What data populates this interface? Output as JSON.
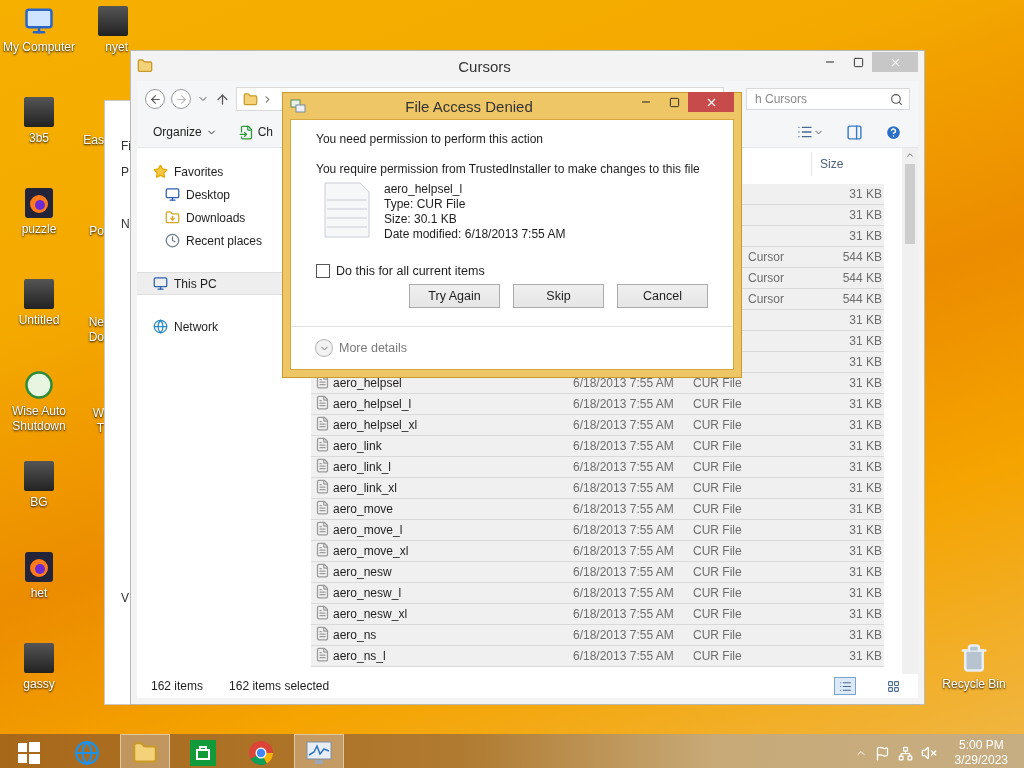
{
  "desktop_icons": [
    {
      "label": "My Computer",
      "kind": "computer"
    },
    {
      "label": "3b5",
      "kind": "photo"
    },
    {
      "label": "puzzle",
      "kind": "browser"
    },
    {
      "label": "Untitled",
      "kind": "photo"
    },
    {
      "label": "Wise Auto Shutdown",
      "kind": "clock"
    },
    {
      "label": "BG",
      "kind": "photo"
    },
    {
      "label": "het",
      "kind": "browser"
    },
    {
      "label": "gassy",
      "kind": "photo"
    }
  ],
  "desktop_icons_covered": [
    {
      "lines": [
        "nyet"
      ],
      "kind": "photo"
    },
    {
      "lines": [
        "Eas"
      ],
      "kind": "covered"
    },
    {
      "lines": [
        "Po"
      ],
      "kind": "covered"
    },
    {
      "lines": [
        "Ne",
        "Do"
      ],
      "kind": "covered"
    },
    {
      "lines": [
        "W",
        "T"
      ],
      "kind": "covered"
    }
  ],
  "recycle_bin": {
    "label": "Recycle Bin"
  },
  "background_window": {
    "fragments": [
      "Fi",
      "P",
      "N",
      "V"
    ]
  },
  "explorer": {
    "title": "Cursors",
    "search": {
      "placeholder": "h Cursors"
    },
    "toolbar": [
      "Organize",
      "Ch"
    ],
    "navigation": [
      {
        "label": "Favorites",
        "kind": "favorites",
        "selected": false,
        "children": [
          {
            "label": "Desktop",
            "kind": "desktop",
            "selected": false
          },
          {
            "label": "Downloads",
            "kind": "downloads",
            "selected": false
          },
          {
            "label": "Recent places",
            "kind": "recent",
            "selected": false
          }
        ]
      },
      {
        "label": "This PC",
        "kind": "pc",
        "selected": true
      },
      {
        "label": "Network",
        "kind": "network",
        "selected": false
      }
    ],
    "columns": [
      "Size"
    ],
    "rows": [
      {
        "kind": "covered",
        "size": "31 KB",
        "selected": true
      },
      {
        "kind": "covered",
        "size": "31 KB",
        "selected": true
      },
      {
        "kind": "covered",
        "size": "31 KB",
        "selected": true
      },
      {
        "kind": "covered",
        "type": "Cursor",
        "size": "544 KB",
        "selected": true
      },
      {
        "kind": "covered",
        "type": "Cursor",
        "size": "544 KB",
        "selected": true
      },
      {
        "kind": "covered",
        "type": "Cursor",
        "size": "544 KB",
        "selected": true
      },
      {
        "kind": "covered",
        "size": "31 KB",
        "selected": true
      },
      {
        "kind": "covered",
        "size": "31 KB",
        "selected": true
      },
      {
        "kind": "covered",
        "size": "31 KB",
        "selected": true
      },
      {
        "kind": "file",
        "name": "aero_helpsel",
        "date": "6/18/2013 7:55 AM",
        "type": "CUR File",
        "size": "31 KB",
        "selected": true
      },
      {
        "kind": "file",
        "name": "aero_helpsel_l",
        "date": "6/18/2013 7:55 AM",
        "type": "CUR File",
        "size": "31 KB",
        "selected": true
      },
      {
        "kind": "file",
        "name": "aero_helpsel_xl",
        "date": "6/18/2013 7:55 AM",
        "type": "CUR File",
        "size": "31 KB",
        "selected": true
      },
      {
        "kind": "file",
        "name": "aero_link",
        "date": "6/18/2013 7:55 AM",
        "type": "CUR File",
        "size": "31 KB",
        "selected": true
      },
      {
        "kind": "file",
        "name": "aero_link_l",
        "date": "6/18/2013 7:55 AM",
        "type": "CUR File",
        "size": "31 KB",
        "selected": true
      },
      {
        "kind": "file",
        "name": "aero_link_xl",
        "date": "6/18/2013 7:55 AM",
        "type": "CUR File",
        "size": "31 KB",
        "selected": true
      },
      {
        "kind": "file",
        "name": "aero_move",
        "date": "6/18/2013 7:55 AM",
        "type": "CUR File",
        "size": "31 KB",
        "selected": true
      },
      {
        "kind": "file",
        "name": "aero_move_l",
        "date": "6/18/2013 7:55 AM",
        "type": "CUR File",
        "size": "31 KB",
        "selected": true
      },
      {
        "kind": "file",
        "name": "aero_move_xl",
        "date": "6/18/2013 7:55 AM",
        "type": "CUR File",
        "size": "31 KB",
        "selected": true
      },
      {
        "kind": "file",
        "name": "aero_nesw",
        "date": "6/18/2013 7:55 AM",
        "type": "CUR File",
        "size": "31 KB",
        "selected": true
      },
      {
        "kind": "file",
        "name": "aero_nesw_l",
        "date": "6/18/2013 7:55 AM",
        "type": "CUR File",
        "size": "31 KB",
        "selected": true
      },
      {
        "kind": "file",
        "name": "aero_nesw_xl",
        "date": "6/18/2013 7:55 AM",
        "type": "CUR File",
        "size": "31 KB",
        "selected": true
      },
      {
        "kind": "file",
        "name": "aero_ns",
        "date": "6/18/2013 7:55 AM",
        "type": "CUR File",
        "size": "31 KB",
        "selected": true
      },
      {
        "kind": "file",
        "name": "aero_ns_l",
        "date": "6/18/2013 7:55 AM",
        "type": "CUR File",
        "size": "31 KB",
        "selected": true
      }
    ],
    "status": {
      "count": "162 items",
      "selected": "162 items selected"
    }
  },
  "dialog": {
    "title": "File Access Denied",
    "heading": "You need permission to perform this action",
    "message": "You require permission from TrustedInstaller to make changes to this file",
    "file": {
      "name": "aero_helpsel_l",
      "type": "Type: CUR File",
      "size": "Size: 30.1 KB",
      "date": "Date modified: 6/18/2013 7:55 AM"
    },
    "checkbox": {
      "label": "Do this for all current items",
      "checked": false
    },
    "buttons": [
      "Try Again",
      "Skip",
      "Cancel"
    ],
    "more_details": "More details"
  },
  "taskbar": {
    "apps": [
      {
        "kind": "start",
        "active": false
      },
      {
        "kind": "ie",
        "active": false
      },
      {
        "kind": "explorer",
        "active": true
      },
      {
        "kind": "store",
        "active": false
      },
      {
        "kind": "chrome",
        "active": false
      },
      {
        "kind": "monitor",
        "active": true
      }
    ],
    "time": "5:00 PM",
    "date": "3/29/2023"
  }
}
